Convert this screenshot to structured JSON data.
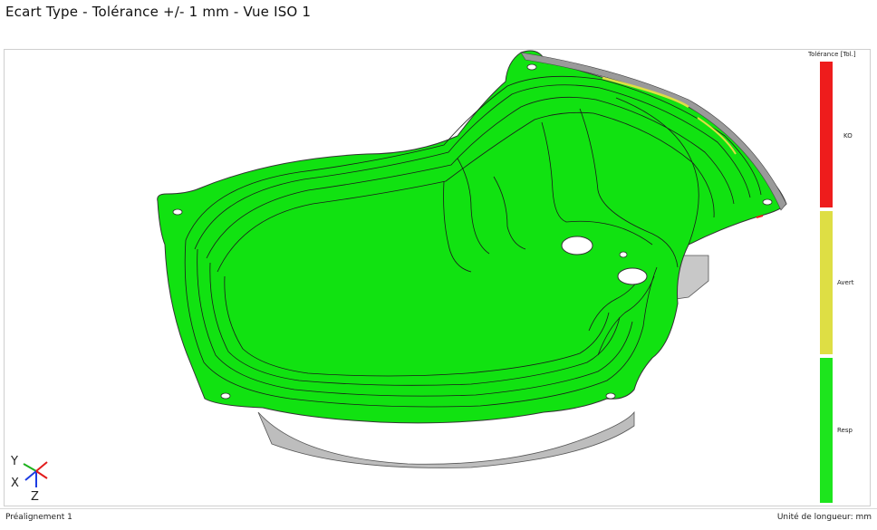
{
  "title": "Ecart Type - Tolérance +/- 1 mm - Vue ISO 1",
  "legend": {
    "title": "Tolérance [Tol.]",
    "bands": [
      {
        "label": "KO",
        "color": "#ee1c1c"
      },
      {
        "label": "Avert",
        "color": "#dede44"
      },
      {
        "label": "Resp",
        "color": "#1de51d"
      }
    ]
  },
  "axes": {
    "y": "Y",
    "x": "X",
    "z": "Z"
  },
  "status": {
    "left": "Préalignement 1",
    "right": "Unité de longueur: mm"
  }
}
